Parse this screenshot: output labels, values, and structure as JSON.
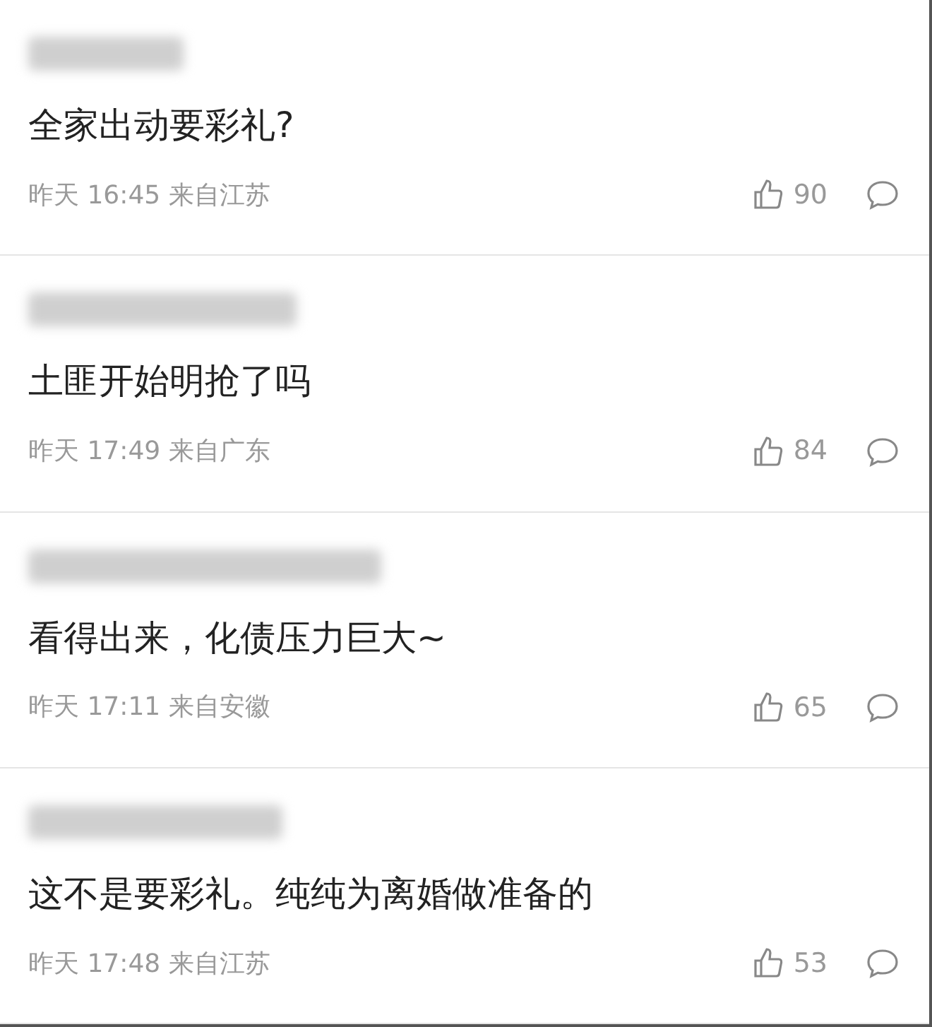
{
  "comments": [
    {
      "text": "全家出动要彩礼?",
      "time": "昨天 16:45 来自江苏",
      "likes": "90"
    },
    {
      "text": "土匪开始明抢了吗",
      "time": "昨天 17:49 来自广东",
      "likes": "84"
    },
    {
      "text": "看得出来，化债压力巨大~",
      "time": "昨天 17:11 来自安徽",
      "likes": "65"
    },
    {
      "text": "这不是要彩礼。纯纯为离婚做准备的",
      "time": "昨天 17:48 来自江苏",
      "likes": "53"
    }
  ]
}
